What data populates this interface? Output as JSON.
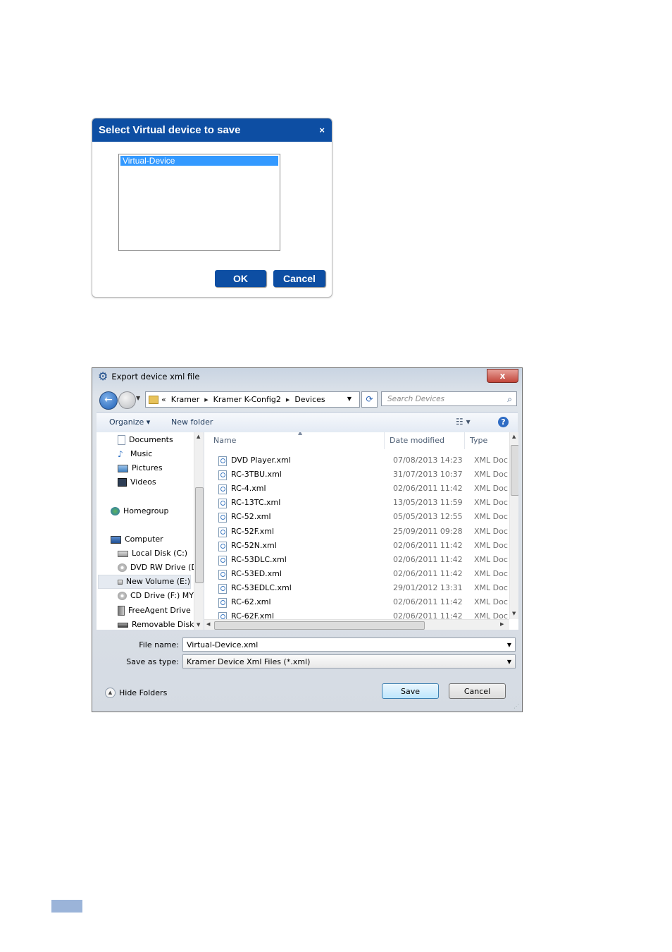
{
  "virtual_dialog": {
    "title": "Select Virtual device to save",
    "close": "×",
    "items": [
      "Virtual-Device"
    ],
    "ok_label": "OK",
    "cancel_label": "Cancel"
  },
  "export_dialog": {
    "title": "Export device xml file",
    "close": "x",
    "address": {
      "overflow": "«",
      "crumbs": [
        "Kramer",
        "Kramer K-Config2",
        "Devices"
      ]
    },
    "search_placeholder": "Search Devices",
    "toolbar": {
      "organize": "Organize ▾",
      "new_folder": "New folder",
      "view": "☷ ▾",
      "help": "?"
    },
    "tree": [
      {
        "label": "Documents",
        "icon": "documents-icon"
      },
      {
        "label": "Music",
        "icon": "music-icon"
      },
      {
        "label": "Pictures",
        "icon": "pictures-icon"
      },
      {
        "label": "Videos",
        "icon": "videos-icon"
      },
      {
        "label": "Homegroup",
        "icon": "homegroup-icon"
      },
      {
        "label": "Computer",
        "icon": "computer-icon"
      },
      {
        "label": "Local Disk (C:)",
        "icon": "disk-icon"
      },
      {
        "label": "DVD RW Drive (D",
        "icon": "dvd-icon"
      },
      {
        "label": "New Volume (E:)",
        "icon": "drive-icon"
      },
      {
        "label": "CD Drive (F:) MY",
        "icon": "cd-icon"
      },
      {
        "label": "FreeAgent Drive (",
        "icon": "external-drive-icon"
      },
      {
        "label": "Removable Disk (",
        "icon": "removable-disk-icon"
      }
    ],
    "columns": {
      "name": "Name",
      "date": "Date modified",
      "type": "Type"
    },
    "files": [
      {
        "name": "DVD Player.xml",
        "date": "07/08/2013 14:23",
        "type": "XML Doc"
      },
      {
        "name": "RC-3TBU.xml",
        "date": "31/07/2013 10:37",
        "type": "XML Doc"
      },
      {
        "name": "RC-4.xml",
        "date": "02/06/2011 11:42",
        "type": "XML Doc"
      },
      {
        "name": "RC-13TC.xml",
        "date": "13/05/2013 11:59",
        "type": "XML Doc"
      },
      {
        "name": "RC-52.xml",
        "date": "05/05/2013 12:55",
        "type": "XML Doc"
      },
      {
        "name": "RC-52F.xml",
        "date": "25/09/2011 09:28",
        "type": "XML Doc"
      },
      {
        "name": "RC-52N.xml",
        "date": "02/06/2011 11:42",
        "type": "XML Doc"
      },
      {
        "name": "RC-53DLC.xml",
        "date": "02/06/2011 11:42",
        "type": "XML Doc"
      },
      {
        "name": "RC-53ED.xml",
        "date": "02/06/2011 11:42",
        "type": "XML Doc"
      },
      {
        "name": "RC-53EDLC.xml",
        "date": "29/01/2012 13:31",
        "type": "XML Doc"
      },
      {
        "name": "RC-62.xml",
        "date": "02/06/2011 11:42",
        "type": "XML Doc"
      },
      {
        "name": "RC-62F.xml",
        "date": "02/06/2011 11:42",
        "type": "XML Doc"
      }
    ],
    "file_name_label": "File name:",
    "file_name_value": "Virtual-Device.xml",
    "save_type_label": "Save as type:",
    "save_type_value": "Kramer Device Xml Files (*.xml)",
    "hide_folders": "Hide Folders",
    "save_label": "Save",
    "cancel_label": "Cancel"
  }
}
